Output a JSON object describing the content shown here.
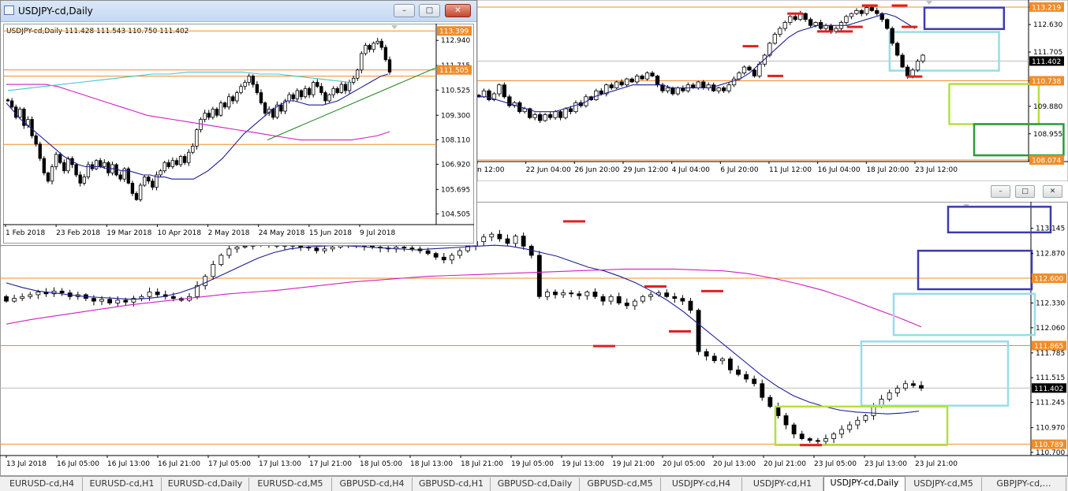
{
  "window": {
    "title": "USDJPY-cd,Daily",
    "minimize_glyph": "–",
    "maximize_glyph": "□",
    "close_glyph": "✕"
  },
  "tabs": [
    {
      "label": "EURUSD-cd,H4",
      "active": false
    },
    {
      "label": "EURUSD-cd,H1",
      "active": false
    },
    {
      "label": "EURUSD-cd,Daily",
      "active": false
    },
    {
      "label": "EURUSD-cd,M5",
      "active": false
    },
    {
      "label": "GBPUSD-cd,H4",
      "active": false
    },
    {
      "label": "GBPUSD-cd,H1",
      "active": false
    },
    {
      "label": "GBPUSD-cd,Daily",
      "active": false
    },
    {
      "label": "GBPUSD-cd,M5",
      "active": false
    },
    {
      "label": "USDJPY-cd,H4",
      "active": false
    },
    {
      "label": "USDJPY-cd,H1",
      "active": false
    },
    {
      "label": "USDJPY-cd,Daily",
      "active": true
    },
    {
      "label": "USDJPY-cd,M5",
      "active": false
    },
    {
      "label": "GBPJPY-cd,…",
      "active": false
    }
  ],
  "chart_data": [
    {
      "id": "daily",
      "type": "candlestick",
      "header": "USDJPY-cd,Daily  111.428 111.543 110.750 111.402",
      "ylim": [
        104.1,
        113.6
      ],
      "yticks": [
        112.94,
        111.715,
        110.525,
        109.3,
        108.11,
        106.92,
        105.695,
        104.505
      ],
      "xticks": [
        "1 Feb 2018",
        "23 Feb 2018",
        "19 Mar 2018",
        "10 Apr 2018",
        "2 May 2018",
        "24 May 2018",
        "15 Jun 2018",
        "9 Jul 2018"
      ],
      "hlines": [
        {
          "value": 113.399,
          "color": "#f08c28"
        },
        {
          "value": 111.505,
          "color": "#f08c28"
        },
        {
          "value": 111.2,
          "color": "#f08c28"
        },
        {
          "value": 107.885,
          "color": "#f08c28"
        }
      ],
      "price_labels": [
        {
          "value": 113.399,
          "text": "113.399",
          "bg": "#f08c28"
        },
        {
          "value": 111.505,
          "text": "111.505",
          "bg": "#f08c28"
        }
      ],
      "closes": [
        110.0,
        109.7,
        109.2,
        109.6,
        108.8,
        109.1,
        108.3,
        107.9,
        107.2,
        106.5,
        106.1,
        106.8,
        107.4,
        107.0,
        106.6,
        107.2,
        106.9,
        106.4,
        106.0,
        106.3,
        106.9,
        106.7,
        107.1,
        106.8,
        107.0,
        106.5,
        106.9,
        106.4,
        106.2,
        106.7,
        106.0,
        105.5,
        105.2,
        105.9,
        106.3,
        106.1,
        105.8,
        106.4,
        106.6,
        107.0,
        106.8,
        107.1,
        106.9,
        107.3,
        107.0,
        107.5,
        107.8,
        108.6,
        109.1,
        109.4,
        109.2,
        109.6,
        109.3,
        109.9,
        109.7,
        110.2,
        110.0,
        110.4,
        110.7,
        110.9,
        111.2,
        110.8,
        110.4,
        109.9,
        109.4,
        109.6,
        109.2,
        109.8,
        109.5,
        110.0,
        110.3,
        110.1,
        110.5,
        110.2,
        110.6,
        110.3,
        110.9,
        110.7,
        110.4,
        110.0,
        110.3,
        110.6,
        110.4,
        110.8,
        110.5,
        110.9,
        111.1,
        111.5,
        112.3,
        112.7,
        112.5,
        112.8,
        112.9,
        112.6,
        112.0,
        111.4
      ],
      "series": [
        {
          "name": "MA fast",
          "color": "#1e1e96",
          "values": [
            109.9,
            109.5,
            109.1,
            108.8,
            108.5,
            108.2,
            107.9,
            107.6,
            107.3,
            107.1,
            106.9,
            106.8,
            106.8,
            106.8,
            106.7,
            106.7,
            106.6,
            106.6,
            106.5,
            106.4,
            106.4,
            106.3,
            106.3,
            106.2,
            106.2,
            106.2,
            106.2,
            106.4,
            106.6,
            106.9,
            107.2,
            107.6,
            108.0,
            108.4,
            108.7,
            109.0,
            109.3,
            109.6,
            109.8,
            110.0,
            110.0,
            109.9,
            109.8,
            109.8,
            109.8,
            109.9,
            110.0,
            110.2,
            110.4,
            110.6,
            110.8,
            111.0,
            111.2,
            111.3
          ]
        },
        {
          "name": "MA slow",
          "color": "#d020c0",
          "values": [
            110.8,
            110.8,
            110.8,
            110.8,
            110.7,
            110.5,
            110.3,
            110.1,
            109.9,
            109.7,
            109.5,
            109.3,
            109.2,
            109.1,
            109.0,
            108.9,
            108.8,
            108.7,
            108.6,
            108.5,
            108.4,
            108.3,
            108.2,
            108.1,
            108.1,
            108.1,
            108.1,
            108.1,
            108.2,
            108.3,
            108.5
          ]
        },
        {
          "name": "MA long",
          "color": "#40c8d0",
          "values": [
            110.5,
            110.6,
            110.7,
            110.8,
            110.9,
            111.0,
            111.1,
            111.2,
            111.3,
            111.3,
            111.4,
            111.4,
            111.4,
            111.4,
            111.3,
            111.3,
            111.2,
            111.1,
            111.0,
            110.9
          ]
        }
      ],
      "trendline": {
        "from": 108.1,
        "to": 111.6,
        "color": "#2a8a2a"
      },
      "xrange_label": ""
    },
    {
      "id": "h4",
      "type": "candlestick",
      "ylim": [
        108.1,
        113.35
      ],
      "yticks": [
        113.219,
        112.63,
        111.705,
        110.738,
        109.88,
        108.955,
        108.074
      ],
      "xticks": [
        "n 12:00",
        "22 Jun 04:00",
        "26 Jun 20:00",
        "29 Jun 12:00",
        "4 Jul 04:00",
        "6 Jul 20:00",
        "11 Jul 12:00",
        "16 Jul 04:00",
        "18 Jul 20:00",
        "23 Jul 12:00"
      ],
      "hlines": [
        {
          "value": 113.219,
          "color": "#f08c28"
        },
        {
          "value": 110.738,
          "color": "#f08c28"
        },
        {
          "value": 108.074,
          "color": "#f08c28"
        },
        {
          "value": 111.402,
          "color": "#bdbdbd"
        }
      ],
      "price_labels": [
        {
          "value": 113.219,
          "text": "113.219",
          "bg": "#f08c28"
        },
        {
          "value": 110.738,
          "text": "110.738",
          "bg": "#f08c28"
        },
        {
          "value": 111.402,
          "text": "111.402",
          "bg": "#000000"
        },
        {
          "value": 108.074,
          "text": "108.074",
          "bg": "#f08c28"
        }
      ],
      "closes": [
        110.2,
        110.4,
        110.1,
        110.3,
        110.6,
        110.2,
        109.9,
        110.0,
        109.7,
        109.8,
        109.5,
        109.6,
        109.4,
        109.6,
        109.5,
        109.7,
        109.5,
        109.8,
        109.7,
        110.0,
        109.9,
        110.2,
        110.1,
        110.4,
        110.3,
        110.6,
        110.5,
        110.7,
        110.6,
        110.8,
        110.7,
        110.9,
        110.8,
        111.0,
        110.9,
        110.6,
        110.4,
        110.5,
        110.3,
        110.5,
        110.4,
        110.6,
        110.5,
        110.7,
        110.5,
        110.6,
        110.4,
        110.5,
        110.4,
        110.6,
        110.8,
        111.0,
        111.2,
        111.1,
        110.9,
        111.3,
        111.6,
        112.0,
        112.3,
        112.5,
        112.7,
        112.9,
        112.8,
        113.0,
        112.8,
        112.6,
        112.7,
        112.5,
        112.6,
        112.4,
        112.5,
        112.7,
        112.9,
        113.0,
        113.1,
        113.0,
        113.2,
        113.1,
        113.0,
        112.8,
        112.5,
        112.0,
        111.6,
        111.2,
        110.9,
        111.1,
        111.4,
        111.6
      ],
      "series": [
        {
          "name": "MA",
          "color": "#1e1e96",
          "values": [
            110.2,
            110.2,
            110.1,
            110.0,
            109.9,
            109.8,
            109.7,
            109.7,
            109.7,
            109.8,
            109.9,
            110.0,
            110.2,
            110.3,
            110.4,
            110.5,
            110.6,
            110.6,
            110.6,
            110.6,
            110.5,
            110.5,
            110.5,
            110.5,
            110.5,
            110.6,
            110.7,
            110.8,
            111.0,
            111.3,
            111.6,
            111.9,
            112.2,
            112.4,
            112.5,
            112.6,
            112.6,
            112.6,
            112.6,
            112.7,
            112.8,
            112.9,
            113.0,
            112.9,
            112.7,
            112.5
          ]
        }
      ],
      "zones": [
        {
          "top": 113.2,
          "bottom": 112.48,
          "x0": 0.9,
          "x1": 1.06,
          "color": "#3a3ab0"
        },
        {
          "top": 112.38,
          "bottom": 111.08,
          "x0": 0.83,
          "x1": 1.05,
          "color": "#9adbe8"
        },
        {
          "top": 110.63,
          "bottom": 109.28,
          "x0": 0.95,
          "x1": 1.13,
          "color": "#b4e040"
        },
        {
          "top": 109.28,
          "bottom": 108.23,
          "x0": 1.0,
          "x1": 1.18,
          "color": "#2a9a3a"
        }
      ],
      "marks": [
        [
          0.64,
          113.0
        ],
        [
          0.79,
          113.27
        ],
        [
          0.85,
          113.27
        ],
        [
          0.7,
          112.4
        ],
        [
          0.74,
          112.4
        ],
        [
          0.76,
          112.55
        ],
        [
          0.87,
          112.55
        ],
        [
          0.55,
          111.9
        ],
        [
          0.6,
          110.9
        ],
        [
          0.88,
          110.88
        ]
      ]
    },
    {
      "id": "m5",
      "type": "candlestick",
      "ylim": [
        110.7,
        113.4
      ],
      "yticks": [
        113.145,
        112.87,
        112.6,
        112.33,
        112.06,
        111.785,
        111.515,
        111.245,
        110.97,
        110.7
      ],
      "xticks": [
        "13 Jul 2018",
        "16 Jul 05:00",
        "16 Jul 13:00",
        "16 Jul 21:00",
        "17 Jul 05:00",
        "17 Jul 13:00",
        "17 Jul 21:00",
        "18 Jul 05:00",
        "18 Jul 13:00",
        "18 Jul 21:00",
        "19 Jul 05:00",
        "19 Jul 13:00",
        "19 Jul 21:00",
        "20 Jul 05:00",
        "20 Jul 13:00",
        "20 Jul 21:00",
        "23 Jul 05:00",
        "23 Jul 13:00",
        "23 Jul 21:00"
      ],
      "hlines": [
        {
          "value": 112.6,
          "color": "#f08c28"
        },
        {
          "value": 111.865,
          "color": "#f08c28"
        },
        {
          "value": 111.402,
          "color": "#bdbdbd"
        },
        {
          "value": 110.789,
          "color": "#f08c28"
        }
      ],
      "price_labels": [
        {
          "value": 112.6,
          "text": "112.600",
          "bg": "#f08c28"
        },
        {
          "value": 111.865,
          "text": "111.865",
          "bg": "#f08c28"
        },
        {
          "value": 111.402,
          "text": "111.402",
          "bg": "#000000"
        },
        {
          "value": 110.789,
          "text": "110.789",
          "bg": "#f08c28"
        }
      ],
      "closes": [
        112.35,
        112.38,
        112.4,
        112.42,
        112.45,
        112.43,
        112.46,
        112.44,
        112.4,
        112.42,
        112.38,
        112.35,
        112.37,
        112.33,
        112.36,
        112.34,
        112.38,
        112.4,
        112.45,
        112.42,
        112.4,
        112.38,
        112.36,
        112.4,
        112.52,
        112.62,
        112.75,
        112.85,
        112.92,
        112.94,
        112.95,
        112.96,
        112.97,
        112.96,
        112.95,
        112.96,
        112.95,
        112.94,
        112.93,
        112.9,
        112.92,
        112.94,
        112.96,
        112.98,
        112.96,
        112.95,
        112.94,
        112.93,
        112.92,
        112.94,
        112.93,
        112.92,
        112.9,
        112.87,
        112.83,
        112.8,
        112.85,
        112.9,
        112.95,
        113.0,
        113.05,
        113.08,
        113.03,
        112.98,
        113.06,
        112.95,
        112.85,
        112.4,
        112.45,
        112.42,
        112.44,
        112.43,
        112.41,
        112.45,
        112.4,
        112.35,
        112.4,
        112.33,
        112.3,
        112.35,
        112.4,
        112.42,
        112.44,
        112.4,
        112.38,
        112.35,
        112.25,
        111.8,
        111.75,
        111.7,
        111.72,
        111.6,
        111.55,
        111.5,
        111.45,
        111.3,
        111.2,
        111.1,
        111.0,
        110.9,
        110.85,
        110.83,
        110.82,
        110.85,
        110.9,
        110.95,
        111.0,
        111.05,
        111.1,
        111.2,
        111.28,
        111.35,
        111.4,
        111.45,
        111.43,
        111.4
      ]
    }
  ]
}
